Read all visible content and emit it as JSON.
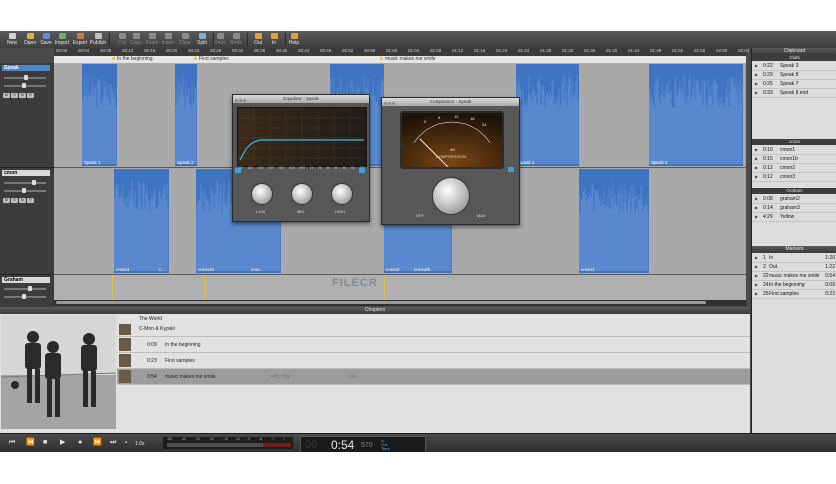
{
  "toolbar": {
    "buttons": [
      {
        "label": "New",
        "icon": "new-icon",
        "enabled": true
      },
      {
        "label": "Open",
        "icon": "folder-icon",
        "enabled": true
      },
      {
        "label": "Save",
        "icon": "save-icon",
        "enabled": true
      },
      {
        "label": "Import",
        "icon": "import-icon",
        "enabled": true
      },
      {
        "label": "Export",
        "icon": "export-icon",
        "enabled": true
      },
      {
        "label": "Publish",
        "icon": "publish-icon",
        "enabled": true
      },
      {
        "label": "Cut",
        "icon": "scissors-icon",
        "enabled": false
      },
      {
        "label": "Copy",
        "icon": "copy-icon",
        "enabled": false
      },
      {
        "label": "Paste",
        "icon": "paste-icon",
        "enabled": false
      },
      {
        "label": "Insert",
        "icon": "insert-icon",
        "enabled": false
      },
      {
        "label": "Clear",
        "icon": "clear-icon",
        "enabled": false
      },
      {
        "label": "Split",
        "icon": "split-icon",
        "enabled": true
      },
      {
        "label": "Undo",
        "icon": "undo-icon",
        "enabled": false
      },
      {
        "label": "Redo",
        "icon": "redo-icon",
        "enabled": false
      },
      {
        "label": "Out",
        "icon": "fade-out-icon",
        "enabled": true
      },
      {
        "label": "In",
        "icon": "fade-in-icon",
        "enabled": true
      },
      {
        "label": "Help",
        "icon": "help-icon",
        "enabled": true
      }
    ]
  },
  "ruler": {
    "ticks": [
      "00:00",
      "00:04",
      "00:08",
      "00:12",
      "00:16",
      "00:20",
      "00:24",
      "00:28",
      "00:32",
      "00:36",
      "00:40",
      "00:44",
      "00:48",
      "00:52",
      "00:56",
      "01:00",
      "01:04",
      "01:08",
      "01:12",
      "01:16",
      "01:20",
      "01:24",
      "01:28",
      "01:32",
      "01:36",
      "01:40",
      "01:44",
      "01:48",
      "01:52",
      "01:56",
      "02:00",
      "02:04"
    ]
  },
  "markers_bar": [
    {
      "label": "In the beginning"
    },
    {
      "label": "First samples"
    },
    {
      "label": "music makes me smile"
    }
  ],
  "tracks": [
    {
      "name": "Speak",
      "selected": true
    },
    {
      "name": "cmon",
      "selected": false
    },
    {
      "name": "Graham",
      "selected": false
    }
  ],
  "clips": {
    "speak": [
      "Speak 1",
      "Speak 2",
      "Speak 4",
      "Speak 5"
    ],
    "cmon": [
      "cmon1",
      "c...",
      "cmon1b",
      "cmo...",
      "cmon2",
      "cmon2b",
      "cmon1"
    ]
  },
  "equalizer": {
    "title": "Equalizer - Speak",
    "knobs": [
      "LOW",
      "MID",
      "HIGH"
    ],
    "freq_labels": [
      "100",
      "150",
      "200",
      "300",
      "400",
      "600",
      "800",
      "1k",
      "2k",
      "3k",
      "4k",
      "6k",
      "8k",
      "10k"
    ]
  },
  "compressor": {
    "title": "Compressor - Speak",
    "meter_unit": "dB",
    "meter_label": "COMPRESSION",
    "scale": [
      "0",
      "6",
      "12",
      "18",
      "24"
    ],
    "knob_min": "OFF",
    "knob_max": "MAX"
  },
  "watermark": "FILECR",
  "clipboard": {
    "title": "Clipboard",
    "sections": [
      {
        "name": "Clark",
        "items": [
          {
            "time": "0:22",
            "name": "Speak 3"
          },
          {
            "time": "0:29",
            "name": "Speak 8"
          },
          {
            "time": "0:25",
            "name": "Speak 7"
          },
          {
            "time": "0:33",
            "name": "Speak 8 end"
          }
        ]
      },
      {
        "name": "cmon",
        "items": [
          {
            "time": "0:10",
            "name": "cmon1"
          },
          {
            "time": "0:15",
            "name": "cmon1b"
          },
          {
            "time": "0:12",
            "name": "cmon2"
          },
          {
            "time": "0:12",
            "name": "cmon3"
          }
        ]
      },
      {
        "name": "Graham",
        "items": [
          {
            "time": "0:08",
            "name": "graham2"
          },
          {
            "time": "0:14",
            "name": "graham3"
          },
          {
            "time": "4:29",
            "name": "Yellow"
          }
        ]
      }
    ]
  },
  "markers_panel": {
    "title": "Markers",
    "items": [
      {
        "num": "1",
        "name": "In",
        "time": "1:20"
      },
      {
        "num": "2",
        "name": "Out",
        "time": "1:22"
      },
      {
        "num": "22",
        "name": "music makes me smile",
        "time": "0:54"
      },
      {
        "num": "24",
        "name": "In the beginning",
        "time": "0:09"
      },
      {
        "num": "25",
        "name": "First samples",
        "time": "0:23"
      }
    ]
  },
  "chapters": {
    "title": "Chapters",
    "album": "The World",
    "artist": "C-Mon & Kypski",
    "rows": [
      {
        "time": "0:09",
        "title": "In the beginning",
        "selected": false
      },
      {
        "time": "0:23",
        "title": "First samples",
        "selected": false
      },
      {
        "time": "0:54",
        "title": "music makes me smile",
        "url_title": "URL Title",
        "url": "URL",
        "selected": true
      }
    ]
  },
  "transport": {
    "speed": "1.0x",
    "meter_scale": [
      "-60",
      "-40",
      "-30",
      "-20",
      "-15",
      "-12",
      "-9",
      "-6",
      "-3",
      "0"
    ],
    "time_dim": "00",
    "time_main": "0:54",
    "time_ms": "570",
    "in_label": "In",
    "out_label": "Out",
    "time_label": "Time"
  },
  "colors": {
    "clip_blue": "#3f74c2",
    "track_selected": "#4d86c9",
    "marker_yellow": "#f0c230",
    "eq_curve": "#3fb8d8"
  }
}
